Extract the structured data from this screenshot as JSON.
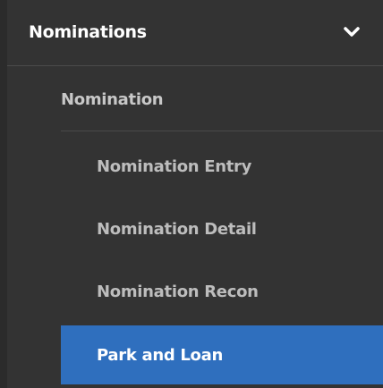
{
  "menu": {
    "header_label": "Nominations",
    "header_icon": "chevron-down-icon",
    "group_label": "Nomination",
    "items": [
      {
        "label": "Nomination Entry",
        "active": false
      },
      {
        "label": "Nomination Detail",
        "active": false
      },
      {
        "label": "Nomination Recon",
        "active": false
      },
      {
        "label": "Park and Loan",
        "active": true
      }
    ]
  },
  "colors": {
    "background": "#333333",
    "active_background": "#2f6fbe",
    "header_text": "#ffffff",
    "item_text": "#bdbdbd"
  }
}
